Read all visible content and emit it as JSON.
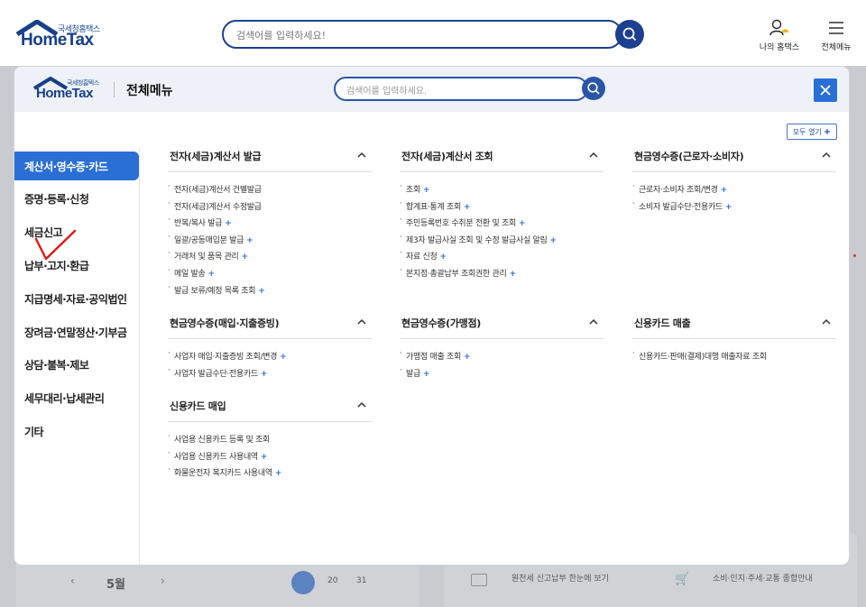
{
  "header": {
    "logo_small": "국세청홈택스",
    "logo_big": "HomeTax",
    "search_placeholder": "검색어를 입력하세요!",
    "my_hometax_label": "나의 홈택스",
    "all_menu_label": "전체메뉴"
  },
  "background": {
    "calendar_month": "5월",
    "calendar_days": [
      "20",
      "31"
    ],
    "card1_text": "원천세 신고납부 한눈에 보기",
    "card2_text": "소비·인지·주세·교통 종합안내"
  },
  "modal": {
    "logo_small": "국세청홈택스",
    "logo_big": "HomeTax",
    "title": "전체메뉴",
    "search_placeholder": "검색어를 입력하세요.",
    "open_all_label": "모두 열기",
    "sidebar": [
      {
        "label": "계산서·영수증·카드"
      },
      {
        "label": "증명·등록·신청"
      },
      {
        "label": "세금신고"
      },
      {
        "label": "납부·고지·환급"
      },
      {
        "label": "지급명세·자료·공익법인"
      },
      {
        "label": "장려금·연말정산·기부금"
      },
      {
        "label": "상담·불복·제보"
      },
      {
        "label": "세무대리·납세관리"
      },
      {
        "label": "기타"
      }
    ],
    "sections": [
      {
        "title": "전자(세금)계산서 발급",
        "items": [
          {
            "label": "전자(세금)계산서 건별발급",
            "plus": false
          },
          {
            "label": "전자(세금)계산서 수정발급",
            "plus": false
          },
          {
            "label": "반복/복사 발급",
            "plus": true
          },
          {
            "label": "일괄/공동매입분 발급",
            "plus": true
          },
          {
            "label": "거래처 및 품목 관리",
            "plus": true
          },
          {
            "label": "메일 발송",
            "plus": true
          },
          {
            "label": "발급 보류/예정 목록 조회",
            "plus": true
          }
        ]
      },
      {
        "title": "전자(세금)계산서 조회",
        "items": [
          {
            "label": "조회",
            "plus": true
          },
          {
            "label": "합계표·통계 조회",
            "plus": true
          },
          {
            "label": "주민등록번호 수취분 전환 및 조회",
            "plus": true
          },
          {
            "label": "제3자 발급사실 조회 및 수정 발급사실 알림",
            "plus": true
          },
          {
            "label": "자료 신청",
            "plus": true
          },
          {
            "label": "본지점·총괄납부 조회권한 관리",
            "plus": true
          }
        ]
      },
      {
        "title": "현금영수증(근로자·소비자)",
        "items": [
          {
            "label": "근로자·소비자 조회/변경",
            "plus": true
          },
          {
            "label": "소비자 발급수단·전용카드",
            "plus": true
          }
        ]
      },
      {
        "title": "현금영수증(매입·지출증빙)",
        "items": [
          {
            "label": "사업자 매입·지출증빙 조회/변경",
            "plus": true
          },
          {
            "label": "사업자 발급수단·전용카드",
            "plus": true
          }
        ]
      },
      {
        "title": "현금영수증(가맹점)",
        "items": [
          {
            "label": "가맹점 매출 조회",
            "plus": true
          },
          {
            "label": "발급",
            "plus": true
          }
        ]
      },
      {
        "title": "신용카드 매출",
        "items": [
          {
            "label": "신용카드·판매(결제)대행 매출자료 조회",
            "plus": false
          }
        ]
      },
      {
        "title": "신용카드 매입",
        "items": [
          {
            "label": "사업용 신용카드 등록 및 조회",
            "plus": false
          },
          {
            "label": "사업용 신용카드 사용내역",
            "plus": true
          },
          {
            "label": "화물운전자 복지카드 사용내역",
            "plus": true
          }
        ]
      }
    ]
  }
}
